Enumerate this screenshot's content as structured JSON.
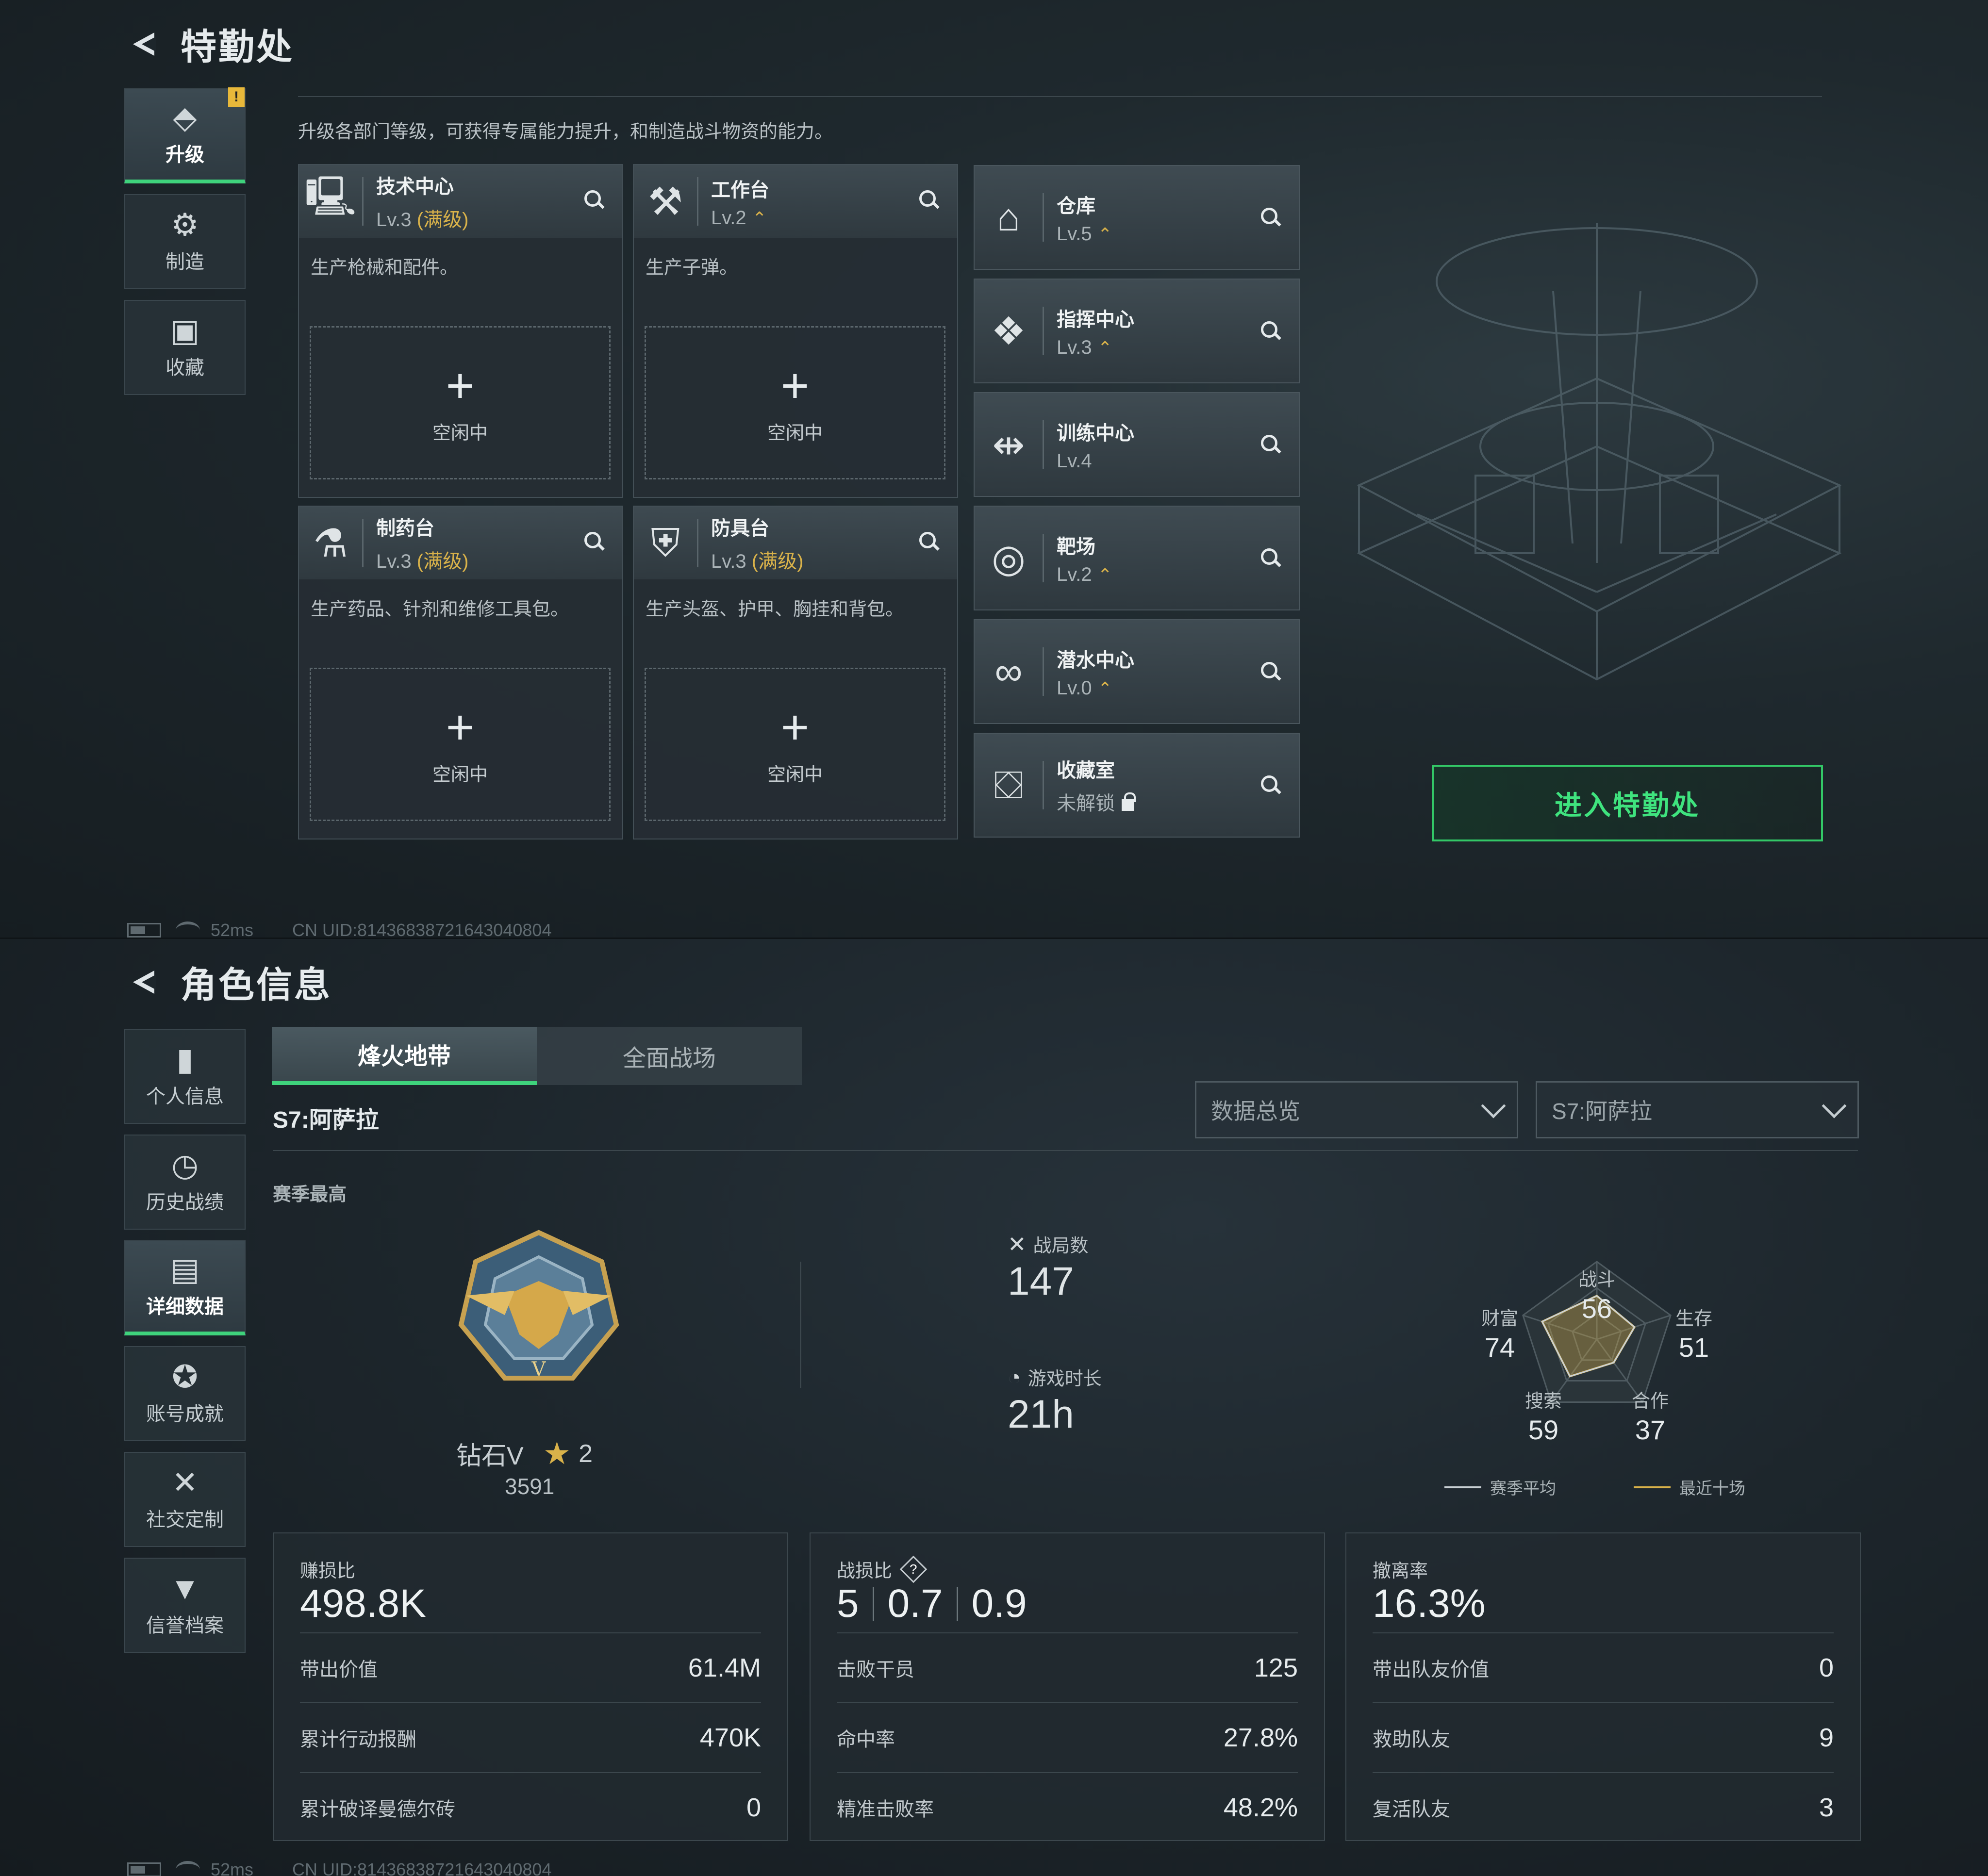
{
  "colors": {
    "accent_green": "#3fd37c",
    "gold": "#d9b24a",
    "badge": "#e8b83a"
  },
  "top": {
    "title": "特勤处",
    "nav": [
      {
        "icon": "upgrade-icon",
        "label": "升级",
        "active": true,
        "badge": "!"
      },
      {
        "icon": "craft-gear-icon",
        "label": "制造",
        "active": false
      },
      {
        "icon": "collection-icon",
        "label": "收藏",
        "active": false
      }
    ],
    "description": "升级各部门等级，可获得专属能力提升，和制造战斗物资的能力。",
    "large_cards": [
      {
        "icon": "monitor-icon",
        "name": "技术中心",
        "level": "Lv.3",
        "max": "(满级)",
        "desc": "生产枪械和配件。",
        "slot_status": "空闲中"
      },
      {
        "icon": "hammer-icon",
        "name": "工作台",
        "level": "Lv.2",
        "upgrade": "⌃",
        "desc": "生产子弹。",
        "slot_status": "空闲中"
      },
      {
        "icon": "pharmacy-icon",
        "name": "制药台",
        "level": "Lv.3",
        "max": "(满级)",
        "desc": "生产药品、针剂和维修工具包。",
        "slot_status": "空闲中"
      },
      {
        "icon": "armor-icon",
        "name": "防具台",
        "level": "Lv.3",
        "max": "(满级)",
        "desc": "生产头盔、护甲、胸挂和背包。",
        "slot_status": "空闲中"
      }
    ],
    "small_cards": [
      {
        "icon": "warehouse-icon",
        "name": "仓库",
        "level": "Lv.5",
        "upgrade": "⌃"
      },
      {
        "icon": "command-center-icon",
        "name": "指挥中心",
        "level": "Lv.3",
        "upgrade": "⌃"
      },
      {
        "icon": "dumbbell-icon",
        "name": "训练中心",
        "level": "Lv.4"
      },
      {
        "icon": "target-icon",
        "name": "靶场",
        "level": "Lv.2",
        "upgrade": "⌃"
      },
      {
        "icon": "diving-mask-icon",
        "name": "潜水中心",
        "level": "Lv.0",
        "upgrade": "⌃"
      },
      {
        "icon": "vault-icon",
        "name": "收藏室",
        "level": "未解锁",
        "locked": true
      }
    ],
    "enter_button": "进入特勤处",
    "status": {
      "ping": "52ms",
      "uid": "CN UID:8143683872164304080​4"
    }
  },
  "bottom": {
    "title": "角色信息",
    "nav": [
      {
        "icon": "bar-chart-icon",
        "label": "个人信息",
        "active": false
      },
      {
        "icon": "history-clock-icon",
        "label": "历史战绩",
        "active": false
      },
      {
        "icon": "detail-data-icon",
        "label": "详细数据",
        "active": true
      },
      {
        "icon": "achievement-icon",
        "label": "账号成就",
        "active": false
      },
      {
        "icon": "social-tools-icon",
        "label": "社交定制",
        "active": false
      },
      {
        "icon": "credit-shield-icon",
        "label": "信誉档案",
        "active": false
      }
    ],
    "tabs": [
      {
        "label": "烽火地带",
        "active": true
      },
      {
        "label": "全面战场",
        "active": false
      }
    ],
    "season_title": "S7:阿萨拉",
    "dropdown_view": "数据总览",
    "dropdown_season": "S7:阿萨拉",
    "section_label": "赛季最高",
    "rank": {
      "name": "钻石V",
      "stars": "2",
      "score": "3591"
    },
    "matches": {
      "label": "战局数",
      "value": "147"
    },
    "playtime": {
      "label": "游戏时长",
      "value": "21h"
    },
    "radar": {
      "axes": [
        {
          "label": "战斗",
          "value": 56
        },
        {
          "label": "生存",
          "value": 51
        },
        {
          "label": "合作",
          "value": 37
        },
        {
          "label": "搜索",
          "value": 59
        },
        {
          "label": "财富",
          "value": 74
        }
      ],
      "legend": [
        {
          "name": "赛季平均",
          "color": "#c9d0d4"
        },
        {
          "name": "最近十场",
          "color": "#d9b24a"
        }
      ]
    },
    "panels": [
      {
        "label": "赚损比",
        "big": [
          "498.8K"
        ],
        "rows": [
          {
            "k": "带出价值",
            "v": "61.4M"
          },
          {
            "k": "累计行动报酬",
            "v": "470K"
          },
          {
            "k": "累计破译曼德尔砖",
            "v": "0"
          }
        ]
      },
      {
        "label": "战损比",
        "help": "?",
        "big": [
          "5",
          "0.7",
          "0.9"
        ],
        "rows": [
          {
            "k": "击败干员",
            "v": "125"
          },
          {
            "k": "命中率",
            "v": "27.8%"
          },
          {
            "k": "精准击败率",
            "v": "48.2%"
          }
        ]
      },
      {
        "label": "撤离率",
        "big": [
          "16.3%"
        ],
        "rows": [
          {
            "k": "带出队友价值",
            "v": "0"
          },
          {
            "k": "救助队友",
            "v": "9"
          },
          {
            "k": "复活队友",
            "v": "3"
          }
        ]
      }
    ],
    "status": {
      "ping": "52ms",
      "uid": "CN UID:8143683872164304080​4"
    }
  }
}
